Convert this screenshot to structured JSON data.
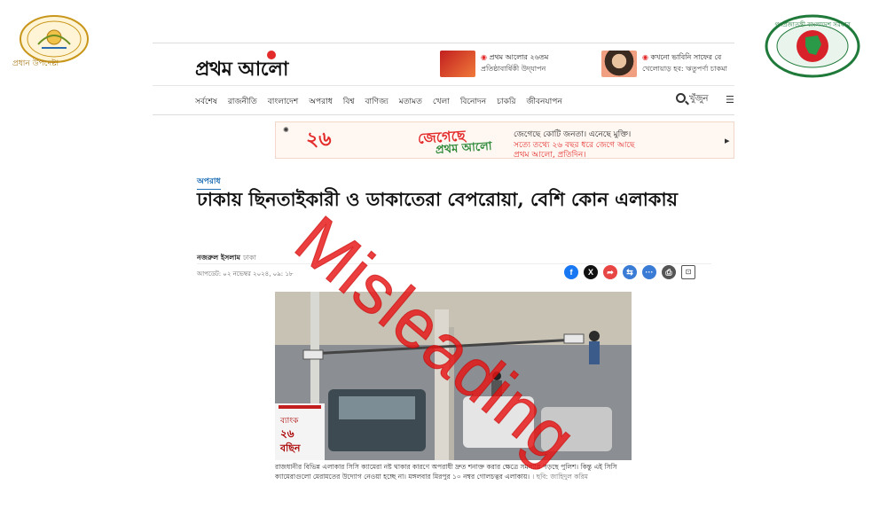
{
  "emblems": {
    "left_caption": "প্রধান উপদেষ্টা",
    "right_ring_text": "গণপ্রজাতন্ত্রী বাংলাদেশ সরকার"
  },
  "masthead": {
    "logo": "প্রথম আলো",
    "promo1_line1": "প্রথম আলোর ২৬তম",
    "promo1_line2": "প্রতিষ্ঠাবার্ষিকী উদ্‌যাপন",
    "promo2_line1": "কখনো ভাবিনি সাফের বে",
    "promo2_line2": "খেলোয়াড় হব: ঋতুপর্ণা চাকমা"
  },
  "nav": {
    "items": [
      "সর্বশেষ",
      "রাজনীতি",
      "বাংলাদেশ",
      "অপরাধ",
      "বিশ্ব",
      "বাণিজ্য",
      "মতামত",
      "খেলা",
      "বিনোদন",
      "চাকরি",
      "জীবনযাপন"
    ],
    "search_label": "খুঁজুন",
    "more_label": "☰"
  },
  "banner": {
    "badge": "২৬",
    "art_line1": "জেগেছে",
    "art_line2": "প্রথম আলো",
    "line1": "জেগেছে কোটি জনতা। এনেছে মুক্তি।",
    "line2": "সত্যে তথ্যে ২৬ বছর ধরে জেগে আছে",
    "line3": "প্রথম আলো, প্রতিদিন।"
  },
  "article": {
    "section": "অপরাধ",
    "headline": "ঢাকায় ছিনতাইকারী ও ডাকাতেরা বেপরোয়া, বেশি কোন এলাকায়",
    "author": "নজরুল ইসলাম",
    "author_sub": "ঢাকা",
    "updated": "আপডেট: ০২ নভেম্বর ২০২৪, ০৯: ১৮",
    "caption": "রাজধানীর বিভিন্ন এলাকার সিসি ক্যামেরা নষ্ট থাকার কারণে অপরাধী দ্রুত শনাক্ত করার ক্ষেত্রে সমস্যায় পড়ছে পুলিশ। কিন্তু এই সিসি ক্যামেরাগুলো মেরামতের উদ্যোগ নেওয়া হচ্ছে না। মঙ্গলবার মিরপুর ১০ নম্বর গোলচত্বর এলাকায়।",
    "credit": "ছবি: জাহিদুল করিম",
    "photo_sign_line1": "ব্যাংক",
    "photo_sign_line2": "২৬",
    "photo_sign_line3": "বছিন"
  },
  "share": {
    "facebook": "f",
    "x": "X",
    "share": "➦",
    "copy": "⇆",
    "more": "···",
    "print": "⎙",
    "save": "⊡"
  },
  "stamp": {
    "text": "Misleading"
  },
  "colors": {
    "brand_red": "#e32b2b",
    "link_blue": "#1f6fb5",
    "stamp_red": "#e61414"
  }
}
